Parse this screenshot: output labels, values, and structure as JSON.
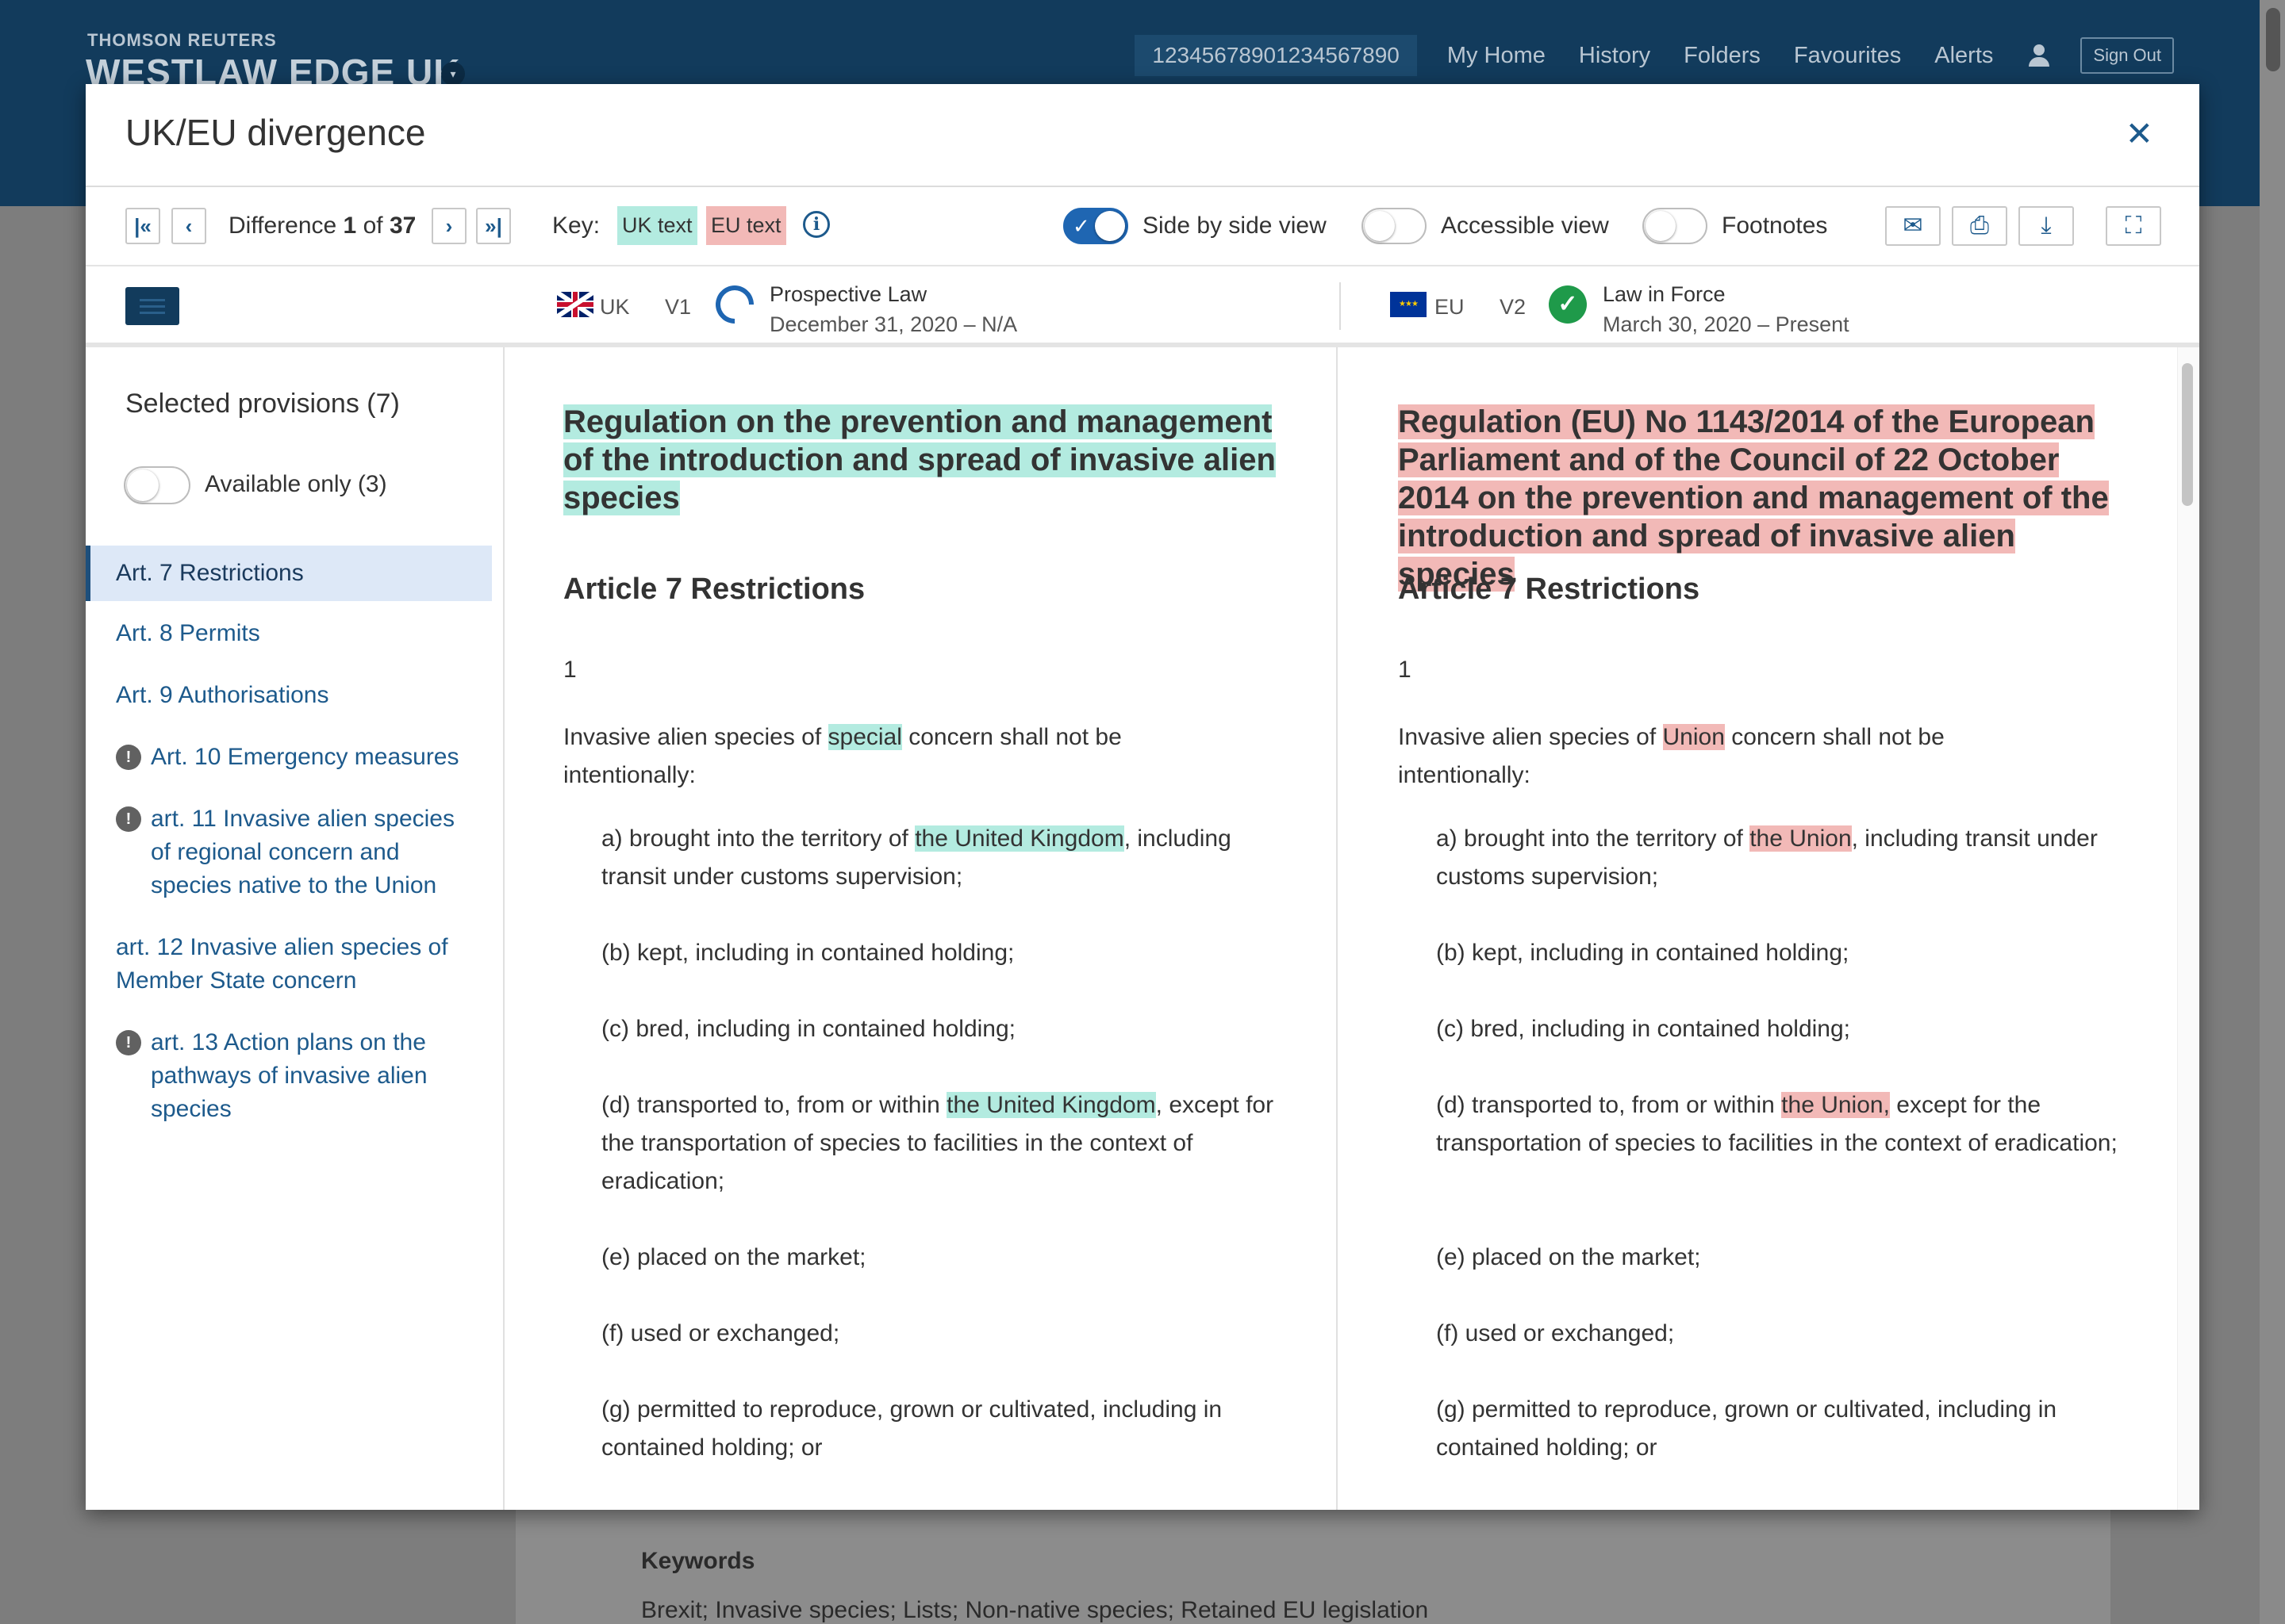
{
  "background": {
    "brand_small": "THOMSON REUTERS",
    "brand": "WESTLAW EDGE UK",
    "client_id": "12345678901234567890",
    "nav": [
      "My Home",
      "History",
      "Folders",
      "Favourites",
      "Alerts"
    ],
    "sign_out": "Sign Out",
    "keywords_label": "Keywords",
    "keywords_text": "Brexit; Invasive species; Lists; Non-native species; Retained EU legislation"
  },
  "modal": {
    "title": "UK/EU divergence",
    "close_icon": "close-icon"
  },
  "toolbar": {
    "difference_label": "Difference",
    "difference_current": "1",
    "difference_of": "of",
    "difference_total": "37",
    "key_label": "Key:",
    "key_uk": "UK text",
    "key_eu": "EU text",
    "side_by_side_label": "Side by side view",
    "side_by_side_on": true,
    "accessible_label": "Accessible view",
    "accessible_on": false,
    "footnotes_label": "Footnotes",
    "footnotes_on": false,
    "icons": [
      "first-icon",
      "prev-icon",
      "next-icon",
      "last-icon",
      "info-icon",
      "email-icon",
      "print-icon",
      "download-icon",
      "fullscreen-icon"
    ]
  },
  "versions": {
    "uk": {
      "jurisdiction": "UK",
      "version": "V1",
      "status": "Prospective Law",
      "dates": "December 31, 2020 – N/A"
    },
    "eu": {
      "jurisdiction": "EU",
      "version": "V2",
      "status": "Law in Force",
      "dates": "March 30, 2020 – Present"
    }
  },
  "sidebar": {
    "title": "Selected provisions (7)",
    "available_label": "Available only (3)",
    "available_on": false,
    "items": [
      {
        "label": "Art. 7 Restrictions",
        "active": true,
        "warning": false
      },
      {
        "label": "Art. 8 Permits",
        "active": false,
        "warning": false
      },
      {
        "label": "Art. 9 Authorisations",
        "active": false,
        "warning": false
      },
      {
        "label": "Art. 10 Emergency measures",
        "active": false,
        "warning": true
      },
      {
        "label": "art. 11 Invasive alien species of regional concern and species native to the Union",
        "active": false,
        "warning": true
      },
      {
        "label": "art. 12 Invasive alien species of Member State concern",
        "active": false,
        "warning": false
      },
      {
        "label": "art. 13 Action plans on the pathways of invasive alien species",
        "active": false,
        "warning": true
      }
    ]
  },
  "uk_doc": {
    "title": "Regulation on the prevention and management of the introduction and spread of invasive alien species",
    "article": "Article 7 Restrictions",
    "number": "1",
    "intro_pre": "Invasive alien species of ",
    "intro_hl": "special",
    "intro_post": " concern shall not be intentionally:",
    "a_pre": "a)   brought into the territory of ",
    "a_hl": "the United Kingdom",
    "a_post": ", including transit under customs supervision;",
    "b": "(b)  kept, including in contained holding;",
    "c": "(c)  bred, including in contained holding;",
    "d_pre": "(d)   transported to, from or within ",
    "d_hl": "the United Kingdom",
    "d_post": ", except for the transportation of species to facilities in the context of eradication;",
    "e": "(e)  placed on the market;",
    "f": "(f)  used or exchanged;",
    "g": "(g)  permitted to reproduce, grown or cultivated, including in contained holding; or"
  },
  "eu_doc": {
    "title": "Regulation (EU) No 1143/2014 of the European Parliament and of the Council of 22 October 2014 on the prevention and management of the introduction and spread of invasive alien species",
    "article": "Article 7 Restrictions",
    "number": "1",
    "intro_pre": "Invasive alien species of ",
    "intro_hl": " Union",
    "intro_post": " concern shall not be intentionally:",
    "a_pre": "a)   brought into the territory of ",
    "a_hl": "the Union",
    "a_post": ", including transit under customs supervision;",
    "b": "(b)  kept, including in contained holding;",
    "c": "(c)  bred, including in contained holding;",
    "d_pre": "(d)   transported to, from or within ",
    "d_hl": "the Union,",
    "d_post": " except for the transportation of species to facilities in the context of eradication;",
    "e": "(e)  placed on the market;",
    "f": "(f)  used or exchanged;",
    "g": "(g)  permitted to reproduce, grown or cultivated, including in contained holding; or"
  }
}
